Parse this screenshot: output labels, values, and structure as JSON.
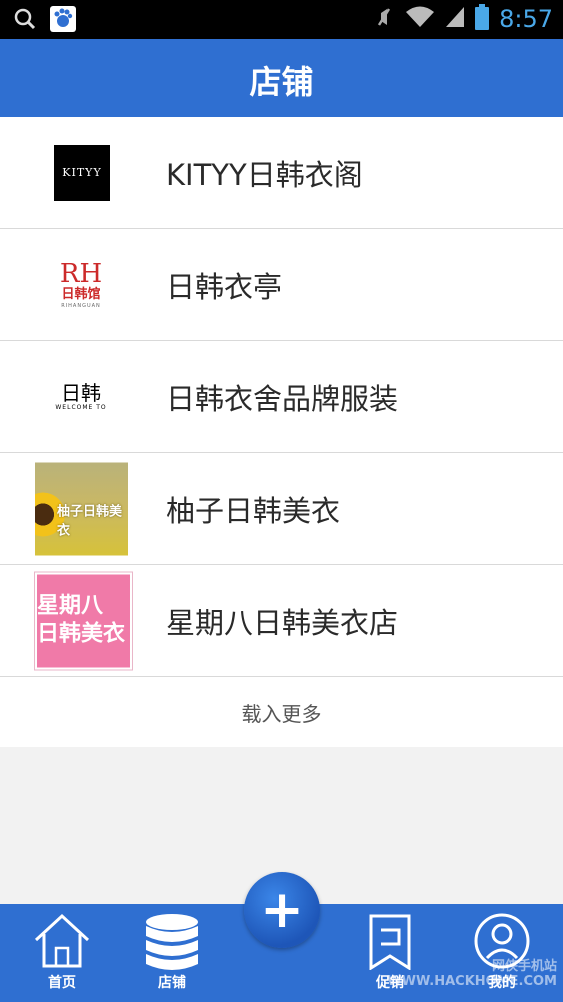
{
  "status_bar": {
    "time": "8:57",
    "icons": [
      "search-icon",
      "baidu-icon",
      "mute-icon",
      "wifi-icon",
      "signal-icon",
      "battery-icon"
    ]
  },
  "header": {
    "title": "店铺"
  },
  "stores": [
    {
      "name": "KITYY日韩衣阁",
      "logo_text": "KITYY"
    },
    {
      "name": "日韩衣亭",
      "logo_text": "日韩馆"
    },
    {
      "name": "日韩衣舍品牌服装",
      "logo_text": "日韩"
    },
    {
      "name": "柚子日韩美衣",
      "logo_text": "柚子日韩美衣"
    },
    {
      "name": "星期八日韩美衣店",
      "logo_text": "星期八 日韩美衣"
    }
  ],
  "load_more": "载入更多",
  "tabbar": {
    "tabs": [
      {
        "label": "首页",
        "icon": "home-icon"
      },
      {
        "label": "店铺",
        "icon": "database-icon"
      },
      {
        "label": "促销",
        "icon": "promo-icon"
      },
      {
        "label": "我的",
        "icon": "user-icon"
      }
    ],
    "fab": "+"
  },
  "watermark": "网侠手机站 WWW.HACKHOME.COM"
}
